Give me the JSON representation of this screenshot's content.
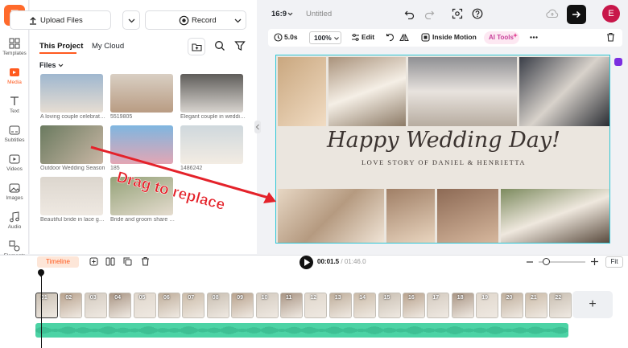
{
  "app": {
    "logo_letter": "F",
    "accent": "#ff5a1f"
  },
  "rail": {
    "items": [
      {
        "label": "Templates",
        "icon": "templates-icon"
      },
      {
        "label": "Media",
        "icon": "media-icon",
        "active": true
      },
      {
        "label": "Text",
        "icon": "text-icon"
      },
      {
        "label": "Subtitles",
        "icon": "subtitles-icon"
      },
      {
        "label": "Videos",
        "icon": "videos-icon"
      },
      {
        "label": "Images",
        "icon": "images-icon"
      },
      {
        "label": "Audio",
        "icon": "audio-icon"
      },
      {
        "label": "Elements",
        "icon": "elements-icon"
      },
      {
        "label": "Effects",
        "icon": "effects-icon"
      },
      {
        "label": "Tools",
        "icon": "tools-icon"
      }
    ]
  },
  "panel": {
    "upload_label": "Upload Files",
    "record_label": "Record",
    "tabs": [
      "This Project",
      "My Cloud"
    ],
    "files_label": "Files",
    "thumbs": [
      {
        "caption": "A loving couple celebrate..."
      },
      {
        "caption": "5519805"
      },
      {
        "caption": "Elegant couple in weddin..."
      },
      {
        "caption": "Outdoor Wedding Season"
      },
      {
        "caption": "185"
      },
      {
        "caption": "1486242"
      },
      {
        "caption": "Beautiful bride in lace go..."
      },
      {
        "caption": "Bride and groom share a t..."
      }
    ]
  },
  "topbar": {
    "aspect": "16:9",
    "title": "Untitled",
    "avatar_letter": "E"
  },
  "toolbar": {
    "duration": "5.0s",
    "zoom": "100%",
    "edit": "Edit",
    "inside_motion": "Inside Motion",
    "ai_tools": "AI Tools"
  },
  "canvas": {
    "title": "Happy Wedding Day!",
    "subtitle": "LOVE STORY OF DANIEL & HENRIETTA"
  },
  "annotation": {
    "text": "Drag to replace"
  },
  "timeline": {
    "label": "Timeline",
    "current": "00:01.5",
    "total": "01:46.0",
    "fit": "Fit",
    "clips": [
      "01",
      "02",
      "03",
      "04",
      "05",
      "06",
      "07",
      "08",
      "09",
      "10",
      "11",
      "12",
      "13",
      "14",
      "15",
      "16",
      "17",
      "18",
      "19",
      "20",
      "21",
      "22"
    ]
  }
}
